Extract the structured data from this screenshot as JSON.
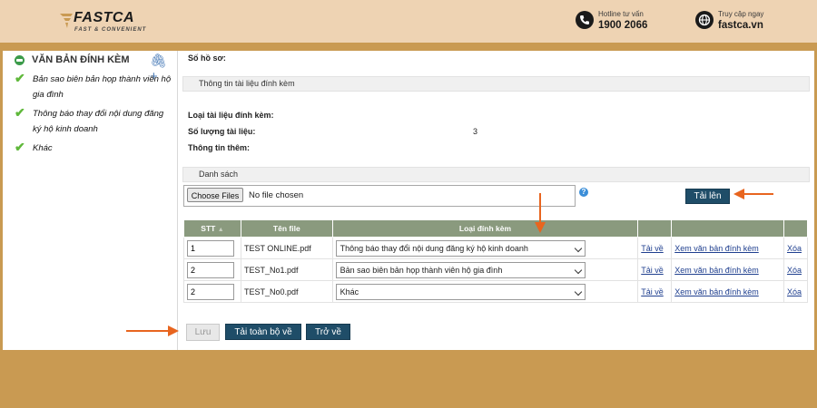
{
  "header": {
    "logo_text": "FASTCA",
    "logo_sub": "FAST & CONVENIENT",
    "hotline_label": "Hotline tư vấn",
    "hotline_number": "1900 2066",
    "site_label": "Truy cập ngay",
    "site_url": "fastca.vn"
  },
  "sidebar": {
    "title": "VĂN BẢN ĐÍNH KÈM",
    "items": [
      {
        "label": "Bản sao biên bản họp thành viên hộ gia đình"
      },
      {
        "label": "Thông báo thay đổi nội dung đăng ký hộ kinh doanh"
      },
      {
        "label": "Khác"
      }
    ]
  },
  "main": {
    "so_ho_so_label": "Số hồ sơ:",
    "section_info": "Thông tin tài liệu đính kèm",
    "loai_label": "Loại tài liệu đính kèm:",
    "so_luong_label": "Số lượng tài liệu:",
    "so_luong_value": "3",
    "thong_tin_label": "Thông tin thêm:",
    "section_list": "Danh sách",
    "choose_files": "Choose Files",
    "no_file": "No file chosen",
    "help": "?",
    "upload_button": "Tải lên",
    "table": {
      "headers": [
        "STT",
        "Tên file",
        "Loại đính kèm"
      ],
      "rows": [
        {
          "stt": "1",
          "file": "TEST ONLINE.pdf",
          "type": "Thông báo thay đổi nội dung đăng ký hộ kinh doanh",
          "download": "Tải về",
          "view": "Xem văn bản đính kèm",
          "delete": "Xóa"
        },
        {
          "stt": "2",
          "file": "TEST_No1.pdf",
          "type": "Bản sao biên bản họp thành viên hộ gia đình",
          "download": "Tải về",
          "view": "Xem văn bản đính kèm",
          "delete": "Xóa"
        },
        {
          "stt": "2",
          "file": "TEST_No0.pdf",
          "type": "Khác",
          "download": "Tải về",
          "view": "Xem văn bản đính kèm",
          "delete": "Xóa"
        }
      ]
    },
    "save_button": "Lưu",
    "download_all_button": "Tải toàn bộ về",
    "back_button": "Trở về"
  },
  "colors": {
    "accent": "#e8651f",
    "button": "#1f4d68",
    "table_header": "#8a9a7e",
    "frame": "#c99a52"
  }
}
